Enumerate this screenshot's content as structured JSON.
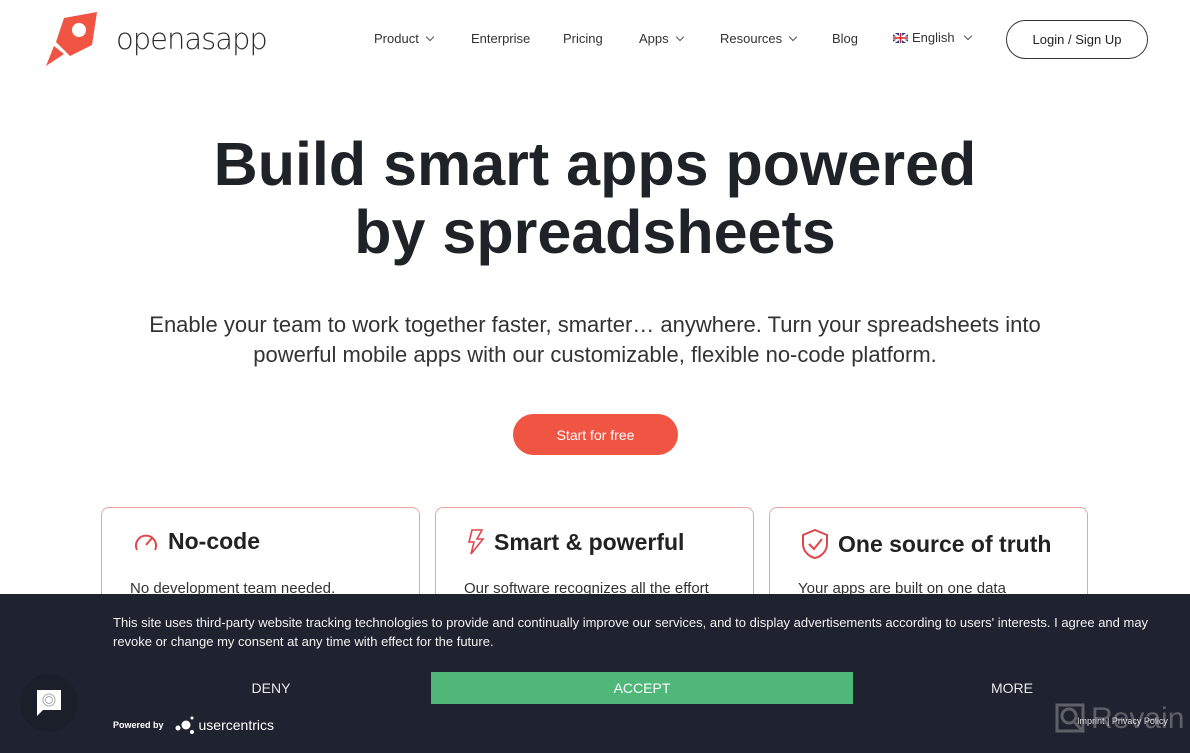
{
  "brand": {
    "name": "openasapp",
    "accent": "#f05442"
  },
  "nav": {
    "items": [
      {
        "label": "Product",
        "dropdown": true
      },
      {
        "label": "Enterprise"
      },
      {
        "label": "Pricing"
      },
      {
        "label": "Apps",
        "dropdown": true
      },
      {
        "label": "Resources",
        "dropdown": true
      },
      {
        "label": "Blog"
      }
    ],
    "language": "English",
    "login": "Login / Sign Up"
  },
  "hero": {
    "title": "Build smart apps powered by spreadsheets",
    "subtitle": "Enable your team to work together faster, smarter… anywhere. Turn your spreadsheets into powerful mobile apps with our customizable, flexible no-code platform.",
    "cta": "Start for free"
  },
  "features": [
    {
      "icon": "speedometer-icon",
      "title": "No-code",
      "text": "No development team needed."
    },
    {
      "icon": "lightning-icon",
      "title": "Smart & powerful",
      "text": "Our software recognizes all the effort"
    },
    {
      "icon": "shield-check-icon",
      "title": "One source of truth",
      "text": "Your apps are built on one data"
    }
  ],
  "cookie": {
    "text": "This site uses third-party website tracking technologies to provide and continually improve our services, and to display advertisements according to users' interests. I agree and may revoke or change my consent at any time with effect for the future.",
    "deny": "DENY",
    "accept": "ACCEPT",
    "more": "MORE",
    "powered_by": "Powered by",
    "provider": "usercentrics",
    "links": "Imprint | Privacy Policy",
    "accept_color": "#4fb878"
  },
  "watermark": "Revain"
}
